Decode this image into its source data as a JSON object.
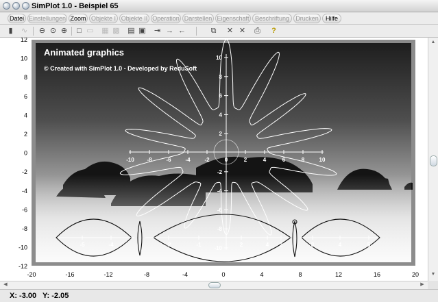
{
  "window": {
    "title": "SimPlot 1.0 - Beispiel 65"
  },
  "menu": [
    {
      "label": "Datei",
      "enabled": true
    },
    {
      "label": "Einstellungen",
      "enabled": false
    },
    {
      "label": "Zoom",
      "enabled": true
    },
    {
      "label": "Objekte I",
      "enabled": false
    },
    {
      "label": "Objekte II",
      "enabled": false
    },
    {
      "label": "Operation",
      "enabled": false
    },
    {
      "label": "Darstellen",
      "enabled": false
    },
    {
      "label": "Eigenschaft",
      "enabled": false
    },
    {
      "label": "Beschriftung",
      "enabled": false
    },
    {
      "label": "Drucken",
      "enabled": false
    },
    {
      "label": "Hilfe",
      "enabled": true
    }
  ],
  "toolbar_icons": [
    "calculator-icon",
    "curve-icon",
    "zoom-out-icon",
    "zoom-icon",
    "zoom-in-icon",
    "square-icon",
    "frame-icon",
    "grid-icon",
    "grid-dense-icon",
    "table-icon",
    "image-icon",
    "export-icon",
    "arrow-right-icon",
    "arrow-left-icon",
    "copy-icon",
    "cross-icon",
    "cross-icon",
    "print-icon",
    "help-icon"
  ],
  "plot": {
    "heading": "Animated graphics",
    "credit": "© Created with SimPlot 1.0 - Developed by ReduSoft",
    "outer_x_ticks": [
      "-20",
      "-16",
      "-12",
      "-8",
      "-4",
      "0",
      "4",
      "8",
      "12",
      "16",
      "20"
    ],
    "outer_y_ticks": [
      "12",
      "10",
      "8",
      "6",
      "4",
      "2",
      "0",
      "-2",
      "-4",
      "-6",
      "-8",
      "-10",
      "-12"
    ],
    "inner_x_ticks": [
      "-10",
      "-8",
      "-6",
      "-4",
      "-2",
      "0",
      "2",
      "4",
      "6",
      "8",
      "10"
    ],
    "inner_y_ticks": [
      "10",
      "8",
      "6",
      "4",
      "2",
      "0",
      "-2",
      "-4",
      "-6",
      "-8",
      "-10"
    ],
    "bottom_labels": [
      "-5",
      "-4",
      "-2",
      "-1",
      "2",
      "4",
      "2",
      "3",
      "4",
      "5"
    ]
  },
  "status": {
    "x": "X: -3.00",
    "y": "Y: -2.05"
  }
}
